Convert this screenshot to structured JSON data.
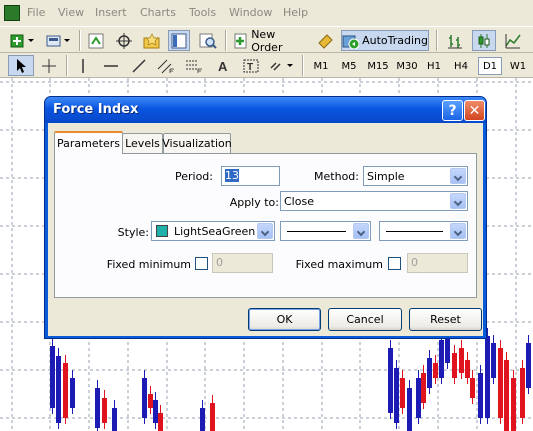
{
  "menubar": {
    "items": [
      "File",
      "View",
      "Insert",
      "Charts",
      "Tools",
      "Window",
      "Help"
    ]
  },
  "toolbar": {
    "new_order_label": "New Order",
    "autotrading_label": "AutoTrading"
  },
  "timeframes": [
    "M1",
    "M5",
    "M15",
    "M30",
    "H1",
    "H4",
    "D1",
    "W1"
  ],
  "selected_timeframe": "D1",
  "dialog": {
    "title": "Force Index",
    "help_glyph": "?",
    "close_glyph": "✕",
    "tabs": [
      "Parameters",
      "Levels",
      "Visualization"
    ],
    "active_tab": "Parameters",
    "period_label": "Period:",
    "period_value": "13",
    "method_label": "Method:",
    "method_value": "Simple",
    "apply_label": "Apply to:",
    "apply_value": "Close",
    "style_label": "Style:",
    "style_color_name": "LightSeaGreen",
    "style_color_hex": "#20b2aa",
    "fixed_min_label": "Fixed minimum",
    "fixed_min_value": "0",
    "fixed_max_label": "Fixed maximum",
    "fixed_max_value": "0",
    "ok_label": "OK",
    "cancel_label": "Cancel",
    "reset_label": "Reset"
  },
  "colors": {
    "bull_candle": "#1c1cb4",
    "bear_candle": "#e0141e",
    "grid": "#9aa2b0",
    "title_bar": "#0a55e0"
  }
}
